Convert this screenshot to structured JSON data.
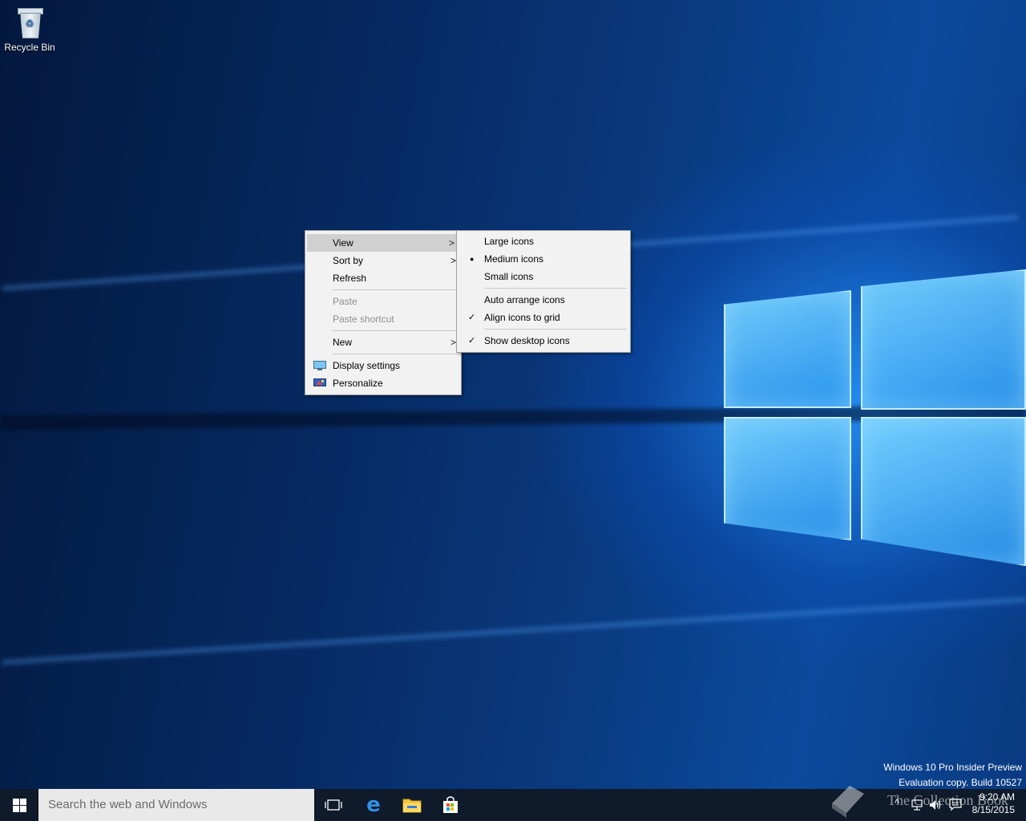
{
  "desktop": {
    "recycle_bin_label": "Recycle Bin",
    "watermark_line1": "Windows 10 Pro Insider Preview",
    "watermark_line2": "Evaluation copy. Build 10527"
  },
  "context_menu": {
    "items": [
      {
        "label": "View"
      },
      {
        "label": "Sort by"
      },
      {
        "label": "Refresh"
      },
      {
        "label": "Paste"
      },
      {
        "label": "Paste shortcut"
      },
      {
        "label": "New"
      },
      {
        "label": "Display settings"
      },
      {
        "label": "Personalize"
      }
    ]
  },
  "view_submenu": {
    "items": [
      {
        "label": "Large icons"
      },
      {
        "label": "Medium icons",
        "mark": "●"
      },
      {
        "label": "Small icons"
      },
      {
        "label": "Auto arrange icons"
      },
      {
        "label": "Align icons to grid",
        "mark": "✓"
      },
      {
        "label": "Show desktop icons",
        "mark": "✓"
      }
    ]
  },
  "taskbar": {
    "search_placeholder": "Search the web and Windows",
    "clock_time": "9:20 AM",
    "clock_date": "8/15/2015",
    "overlay_text": "The Collection Book"
  },
  "colors": {
    "taskbar": "#0f1a2a",
    "menu_bg": "#f2f2f2",
    "menu_highlight": "#d0d0d0",
    "disabled_text": "#8d8d8d"
  }
}
